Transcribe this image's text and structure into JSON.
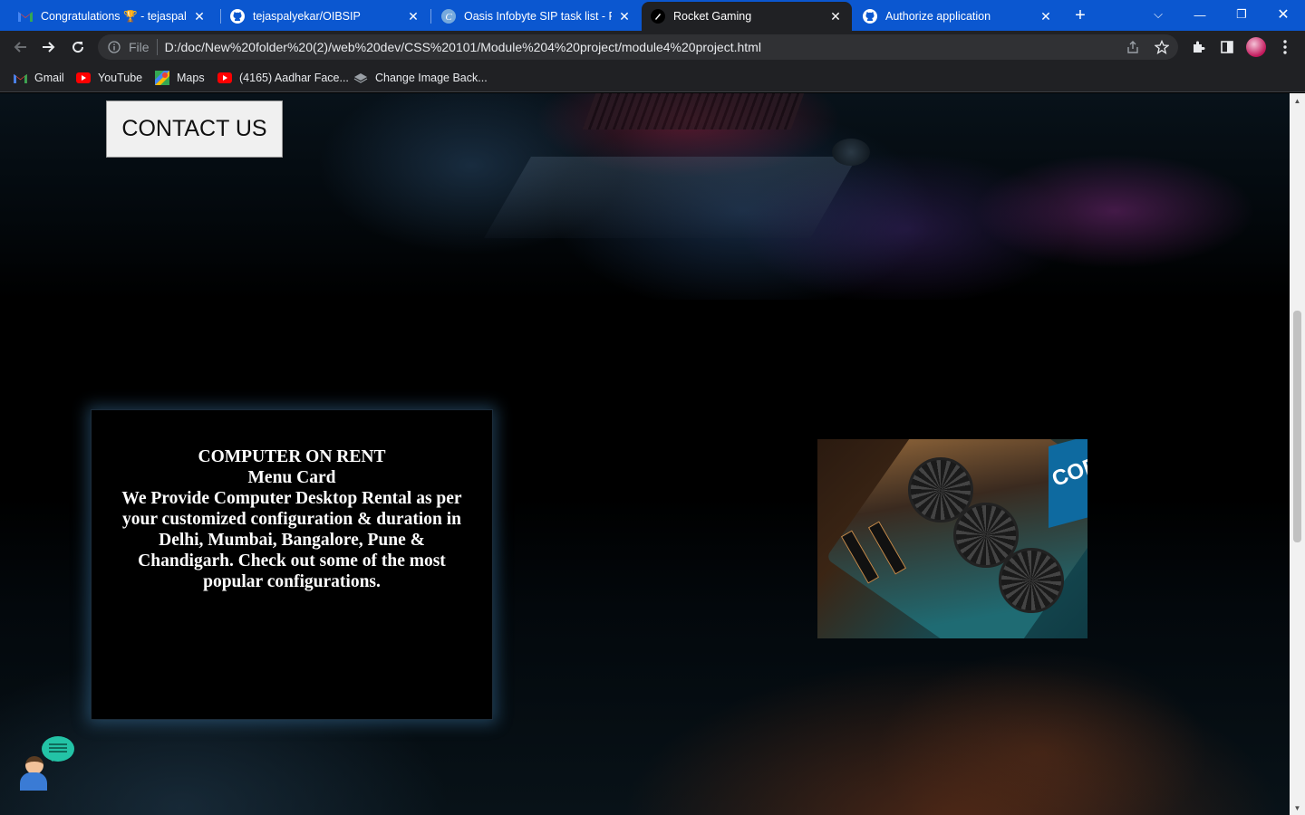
{
  "tabs": [
    {
      "title": "Congratulations 🏆 - tejaspalyekar",
      "favicon": "gmail-icon",
      "close": "✕"
    },
    {
      "title": "tejaspalyekar/OIBSIP",
      "favicon": "github-icon",
      "close": "✕"
    },
    {
      "title": "Oasis Infobyte SIP task list - Preview",
      "favicon": "canva-icon",
      "close": "✕"
    },
    {
      "title": "Rocket Gaming",
      "favicon": "rocket-icon",
      "close": "✕",
      "active": true
    },
    {
      "title": "Authorize application",
      "favicon": "github-icon",
      "close": "✕"
    }
  ],
  "new_tab": "+",
  "window_controls": {
    "list": "⌵",
    "minimize": "—",
    "restore": "❐",
    "close": "✕"
  },
  "toolbar": {
    "scheme": "File",
    "url": "D:/doc/New%20folder%20(2)/web%20dev/CSS%20101/Module%204%20project/module4%20project.html"
  },
  "bookmarks": [
    {
      "label": "Gmail",
      "icon": "gmail-icon"
    },
    {
      "label": "YouTube",
      "icon": "youtube-icon"
    },
    {
      "label": "Maps",
      "icon": "maps-icon"
    },
    {
      "label": "(4165) Aadhar Face...",
      "icon": "youtube-icon"
    },
    {
      "label": "Change Image Back...",
      "icon": "layers-icon"
    }
  ],
  "page": {
    "contact_button": "CONTACT US",
    "menu_card": {
      "title": "COMPUTER ON RENT",
      "subtitle": "Menu Card",
      "description": "We Provide Computer Desktop Rental as per your customized configuration & duration in Delhi, Mumbai, Bangalore, Pune & Chandigarh. Check out some of the most popular configurations."
    },
    "gpu_box_text": "CORE"
  },
  "colors": {
    "tab_bar": "#0b57d0",
    "chrome_dark": "#202124",
    "card_glow": "#50a0dc",
    "chat_bubble": "#23c3a6"
  }
}
